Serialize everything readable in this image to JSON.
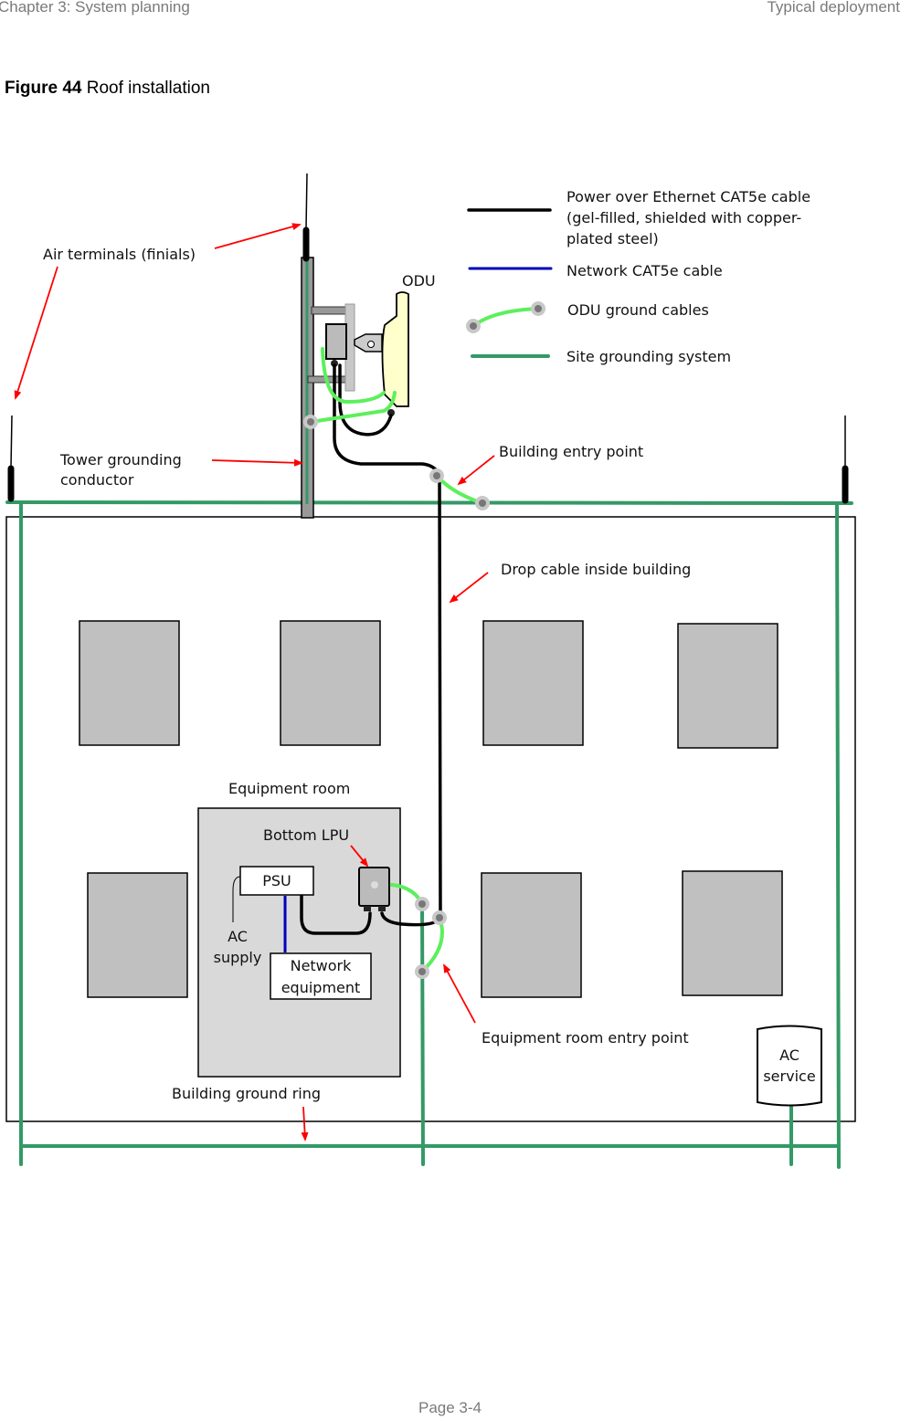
{
  "header": {
    "left": "Chapter 3:  System planning",
    "right": "Typical deployment"
  },
  "figure": {
    "number": "Figure 44",
    "caption": "Roof installation"
  },
  "legend": {
    "items": [
      {
        "label_lines": [
          "Power over Ethernet CAT5e cable",
          "(gel-filled, shielded with copper-",
          "plated steel)"
        ],
        "style": "poe-cable",
        "color": "#000000"
      },
      {
        "label_lines": [
          "Network CAT5e cable"
        ],
        "style": "network-cable",
        "color": "#0000c0"
      },
      {
        "label_lines": [
          "ODU ground cables"
        ],
        "style": "odu-ground",
        "color": "#5cf05c"
      },
      {
        "label_lines": [
          "Site grounding system"
        ],
        "style": "site-ground",
        "color": "#339966"
      }
    ]
  },
  "labels": {
    "air_terminals": "Air terminals (finials)",
    "odu": "ODU",
    "tower_grounding": [
      "Tower grounding",
      "conductor"
    ],
    "building_entry": "Building entry point",
    "drop_cable": "Drop cable inside building",
    "equipment_room": "Equipment room",
    "bottom_lpu": "Bottom LPU",
    "psu": "PSU",
    "ac_supply": [
      "AC",
      "supply"
    ],
    "network_equipment": [
      "Network",
      "equipment"
    ],
    "equipment_room_entry": "Equipment room entry point",
    "ac_service": [
      "AC",
      "service"
    ],
    "building_ground_ring": "Building ground ring"
  },
  "colors": {
    "site_ground": "#339966",
    "odu_ground": "#5cf05c",
    "arrow": "#ff0000",
    "room_fill": "#d9d9d9",
    "window_fill": "#c0c0c0",
    "odu_fill": "#ffffcc"
  },
  "footer": {
    "page": "Page 3-4"
  }
}
